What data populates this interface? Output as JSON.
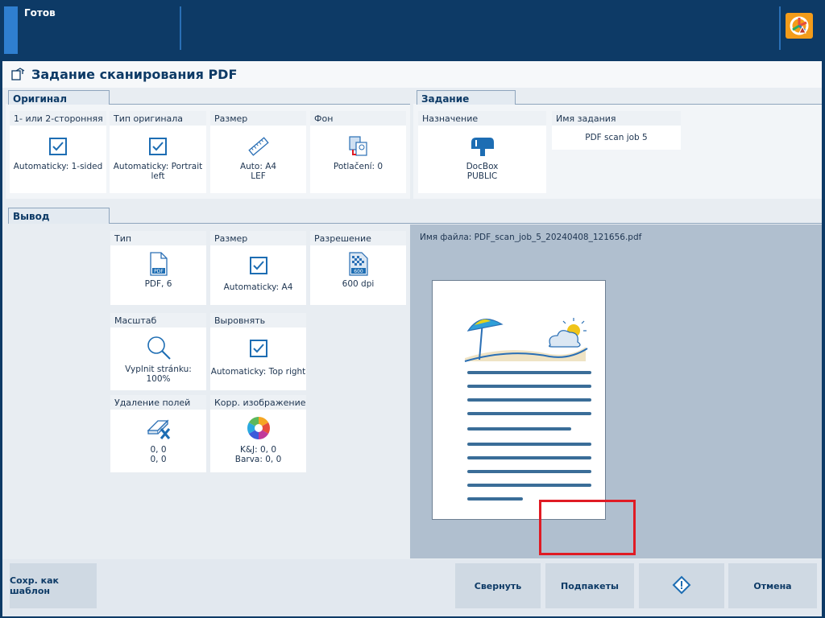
{
  "status": {
    "text": "Готов"
  },
  "title": "Задание сканирования PDF",
  "original": {
    "tab": "Оригинал",
    "tiles": [
      {
        "label": "1- или 2-сторонняя",
        "value": "Automaticky: 1-sided",
        "icon": "checkbox-icon"
      },
      {
        "label": "Тип оригинала",
        "value": "Automaticky: Portrait left",
        "icon": "checkbox-icon"
      },
      {
        "label": "Размер",
        "value": "Auto: A4\nLEF",
        "icon": "ruler-icon"
      },
      {
        "label": "Фон",
        "value": "Potlačení: 0",
        "icon": "background-icon"
      }
    ]
  },
  "job": {
    "tab": "Задание",
    "destination_label": "Назначение",
    "destination_value": "DocBox\nPUBLIC",
    "destination_icon": "mailbox-icon",
    "name_label": "Имя задания",
    "name_value": "PDF scan job 5"
  },
  "output": {
    "tab": "Вывод",
    "tiles": [
      {
        "label": "Тип",
        "value": "PDF, 6",
        "icon": "pdf-file-icon"
      },
      {
        "label": "Размер",
        "value": "Automaticky: A4",
        "icon": "checkbox-icon"
      },
      {
        "label": "Разрешение",
        "value": "600 dpi",
        "icon": "resolution-icon"
      },
      {
        "label": "Масштаб",
        "value": "Vyplnit stránku:\n100%",
        "icon": "zoom-icon"
      },
      {
        "label": "Выровнять",
        "value": "Automaticky: Top right",
        "icon": "checkbox-icon"
      },
      {
        "label": "Удаление полей",
        "value": "0, 0\n0, 0",
        "icon": "erase-edges-icon"
      },
      {
        "label": "Корр. изображение",
        "value": "K&J: 0, 0\nBarva: 0, 0",
        "icon": "color-wheel-icon"
      }
    ]
  },
  "preview": {
    "filename": "Имя файла: PDF_scan_job_5_20240408_121656.pdf"
  },
  "buttons": {
    "save_template": "Сохр. как шаблон",
    "collapse": "Свернуть",
    "subsets": "Подпакеты",
    "cancel": "Отмена"
  },
  "colors": {
    "accent": "#0d3a66",
    "highlight": "#e01b24",
    "check": "#1d6db3"
  }
}
